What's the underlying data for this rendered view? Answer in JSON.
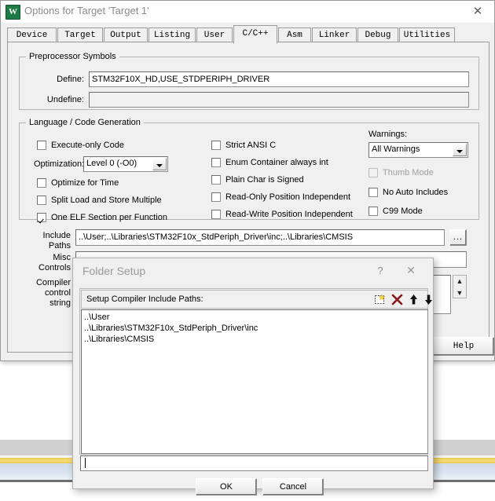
{
  "window": {
    "title": "Options for Target 'Target 1'",
    "app_icon": "keil-uvision-icon",
    "close_label": "✕"
  },
  "tabs": [
    {
      "label": "Device",
      "active": false
    },
    {
      "label": "Target",
      "active": false
    },
    {
      "label": "Output",
      "active": false
    },
    {
      "label": "Listing",
      "active": false
    },
    {
      "label": "User",
      "active": false
    },
    {
      "label": "C/C++",
      "active": true
    },
    {
      "label": "Asm",
      "active": false
    },
    {
      "label": "Linker",
      "active": false
    },
    {
      "label": "Debug",
      "active": false
    },
    {
      "label": "Utilities",
      "active": false
    }
  ],
  "preprocessor": {
    "group_title": "Preprocessor Symbols",
    "define_label": "Define:",
    "define_value": "STM32F10X_HD,USE_STDPERIPH_DRIVER",
    "undefine_label": "Undefine:",
    "undefine_value": ""
  },
  "language": {
    "group_title": "Language / Code Generation",
    "col1": [
      {
        "label": "Execute-only Code",
        "checked": false,
        "enabled": true
      },
      {
        "label": "Optimize for Time",
        "checked": false,
        "enabled": true
      },
      {
        "label": "Split Load and Store Multiple",
        "checked": false,
        "enabled": true
      },
      {
        "label": "One ELF Section per Function",
        "checked": true,
        "enabled": true
      }
    ],
    "optimization_label": "Optimization:",
    "optimization_value": "Level 0 (-O0)",
    "col2": [
      {
        "label": "Strict ANSI C",
        "checked": false,
        "enabled": true
      },
      {
        "label": "Enum Container always int",
        "checked": false,
        "enabled": true
      },
      {
        "label": "Plain Char is Signed",
        "checked": false,
        "enabled": true
      },
      {
        "label": "Read-Only Position Independent",
        "checked": false,
        "enabled": true
      },
      {
        "label": "Read-Write Position Independent",
        "checked": false,
        "enabled": true
      }
    ],
    "warnings_label": "Warnings:",
    "warnings_value": "All Warnings",
    "col3": [
      {
        "label": "Thumb Mode",
        "checked": false,
        "enabled": false
      },
      {
        "label": "No Auto Includes",
        "checked": false,
        "enabled": true
      },
      {
        "label": "C99 Mode",
        "checked": false,
        "enabled": true
      }
    ]
  },
  "paths": {
    "include_label_line1": "Include",
    "include_label_line2": "Paths",
    "include_value": "..\\User;..\\Libraries\\STM32F10x_StdPeriph_Driver\\inc;..\\Libraries\\CMSIS",
    "browse_label": "...",
    "misc_label_line1": "Misc",
    "misc_label_line2": "Controls",
    "misc_value": "",
    "compiler_label_line1": "Compiler",
    "compiler_label_line2": "control",
    "compiler_label_line3": "string",
    "compiler_value": ""
  },
  "main_buttons": {
    "help_label": "Help"
  },
  "folder_dialog": {
    "title": "Folder Setup",
    "help_label": "?",
    "close_label": "✕",
    "list_label": "Setup Compiler Include Paths:",
    "tools": [
      {
        "name": "new-folder-icon",
        "glyph": "new"
      },
      {
        "name": "delete-icon",
        "glyph": "delete"
      },
      {
        "name": "move-up-icon",
        "glyph": "up"
      },
      {
        "name": "move-down-icon",
        "glyph": "down"
      }
    ],
    "paths": [
      "..\\User",
      "..\\Libraries\\STM32F10x_StdPeriph_Driver\\inc",
      "..\\Libraries\\CMSIS"
    ],
    "ok_label": "OK",
    "cancel_label": "Cancel"
  },
  "colors": {
    "dialog_face": "#f0f0f0",
    "accent_yellow": "#f5d76e",
    "accent_blue": "#cfdcea",
    "delete_icon_red": "#8b1a1a",
    "app_icon_green": "#1e7a45"
  }
}
